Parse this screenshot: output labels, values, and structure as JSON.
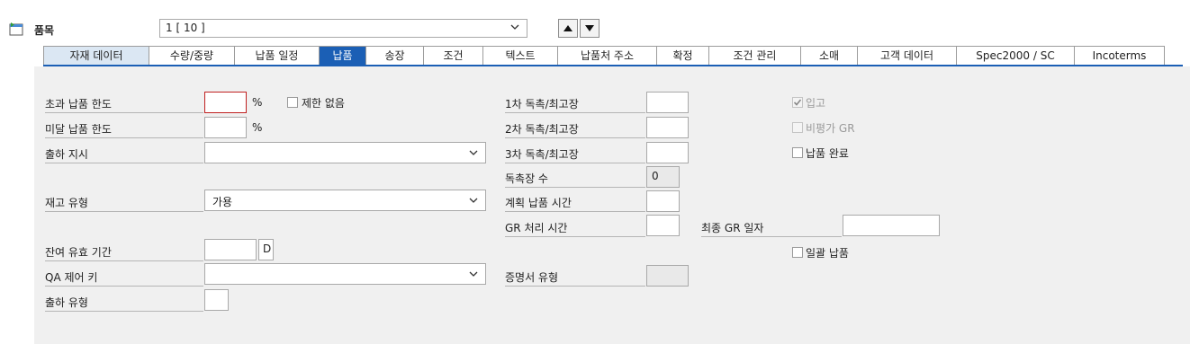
{
  "header": {
    "item_label": "품목",
    "item_value": "1 [ 10 ]"
  },
  "tabs": [
    {
      "label": "자재 데이터"
    },
    {
      "label": "수량/중량"
    },
    {
      "label": "납품 일정"
    },
    {
      "label": "납품"
    },
    {
      "label": "송장"
    },
    {
      "label": "조건"
    },
    {
      "label": "텍스트"
    },
    {
      "label": "납품처 주소"
    },
    {
      "label": "확정"
    },
    {
      "label": "조건 관리"
    },
    {
      "label": "소매"
    },
    {
      "label": "고객 데이터"
    },
    {
      "label": "Spec2000 / SC"
    },
    {
      "label": "Incoterms"
    }
  ],
  "active_tab": "납품",
  "left": {
    "over_tolerance": {
      "label": "초과 납품 한도",
      "value": "",
      "unit": "%"
    },
    "unlimited": {
      "label": "제한 없음",
      "checked": false
    },
    "under_tolerance": {
      "label": "미달 납품 한도",
      "value": "",
      "unit": "%"
    },
    "shipping_instr": {
      "label": "출하 지시",
      "value": ""
    },
    "stock_type": {
      "label": "재고 유형",
      "value": "가용"
    },
    "remaining_shelf": {
      "label": "잔여 유효 기간",
      "value": "",
      "unit": "D"
    },
    "qa_control": {
      "label": "QA 제어 키",
      "value": ""
    },
    "shipping_type": {
      "label": "출하 유형",
      "value": ""
    }
  },
  "middle": {
    "reminder1": {
      "label": "1차 독촉/최고장",
      "value": ""
    },
    "reminder2": {
      "label": "2차 독촉/최고장",
      "value": ""
    },
    "reminder3": {
      "label": "3차 독촉/최고장",
      "value": ""
    },
    "reminder_count": {
      "label": "독촉장 수",
      "value": "0"
    },
    "planned_delivery": {
      "label": "계획 납품 시간",
      "value": ""
    },
    "gr_processing": {
      "label": "GR 처리 시간",
      "value": ""
    },
    "cert_type": {
      "label": "증명서 유형",
      "value": ""
    }
  },
  "right": {
    "goods_receipt": {
      "label": "입고",
      "checked": true
    },
    "non_valuated_gr": {
      "label": "비평가 GR",
      "checked": false
    },
    "delivery_complete": {
      "label": "납품 완료",
      "checked": false
    },
    "last_gr_date": {
      "label": "최종 GR 일자",
      "value": ""
    },
    "bulk_delivery": {
      "label": "일괄 납품",
      "checked": false
    }
  },
  "colors": {
    "accent": "#1b5fb5",
    "panel": "#f0f0f0"
  }
}
